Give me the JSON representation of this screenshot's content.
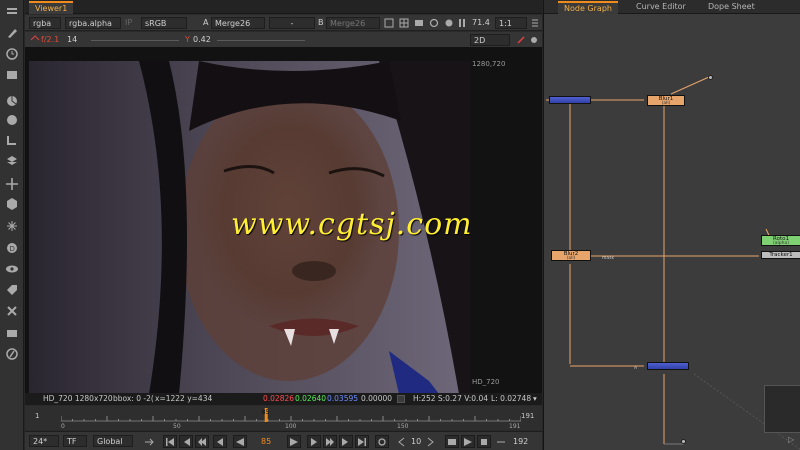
{
  "viewer": {
    "tab_label": "Viewer1",
    "channels": "rgba",
    "alpha_channel": "rgba.alpha",
    "proxy_label": "IP",
    "colorspace": "sRGB",
    "a_label": "A",
    "a_input": "Merge26",
    "op": "-",
    "b_label": "B",
    "b_input": "Merge26",
    "zoom": "71.4",
    "ratio": "1:1",
    "fstop": "f/2.1",
    "fstop_value": "14",
    "gamma_label": "Y",
    "gamma_value": "0.42",
    "view_mode": "2D",
    "res_top": "1280,720",
    "res_bottom": "HD_720",
    "watermark": "www.cgtsj.com"
  },
  "infobar": {
    "format": "HD_720 1280x720",
    "bbox": "bbox: 0 -2(",
    "coords": "x=1222 y=434",
    "r": "0.02826",
    "g": "0.02640",
    "b": "0.03595",
    "a": "0.00000",
    "hsv": "H:252 S:0.27 V:0.04",
    "lum": "L: 0.02748"
  },
  "timeline": {
    "start": "1",
    "ticks": [
      "0",
      "50",
      "100",
      "150",
      "191"
    ],
    "current": "85",
    "end": "191",
    "current_fraction": 0.445
  },
  "transport": {
    "fps": "24*",
    "tf": "TF",
    "scope": "Global",
    "frame": "85",
    "step": "10",
    "end": "192"
  },
  "graph": {
    "tabs": [
      "Node Graph",
      "Curve Editor",
      "Dope Sheet"
    ],
    "nodes": [
      {
        "label": "Blur1",
        "sub": "(all)",
        "kind": "blur"
      },
      {
        "label": "Blur2",
        "sub": "(all)",
        "kind": "blur"
      },
      {
        "label": "Roto1",
        "sub": "(alpha)",
        "kind": "roto"
      },
      {
        "label": "Tracker1",
        "sub": "",
        "kind": "tracker"
      },
      {
        "label": "",
        "sub": "",
        "kind": "merge"
      },
      {
        "label": "",
        "sub": "",
        "kind": "merge"
      }
    ],
    "pipe_labels": [
      "mask",
      "A"
    ]
  },
  "colors": {
    "accent": "#f08c1e",
    "blur_node": "#e8a56b",
    "merge_node": "#3a4cb8",
    "roto_node": "#7fcf73",
    "pipe": "#e8a56b",
    "r_text": "#ff4d4d",
    "g_text": "#55ee55",
    "b_text": "#6f8bff"
  },
  "icons": [
    "viewer-icon",
    "time-icon",
    "draw-icon",
    "color-icon",
    "merge-icon",
    "transform-icon",
    "3d-icon",
    "particles-icon",
    "deep-icon",
    "views-icon",
    "metadata-icon",
    "toolsets-icon",
    "other-icon",
    "furnace-icon"
  ]
}
